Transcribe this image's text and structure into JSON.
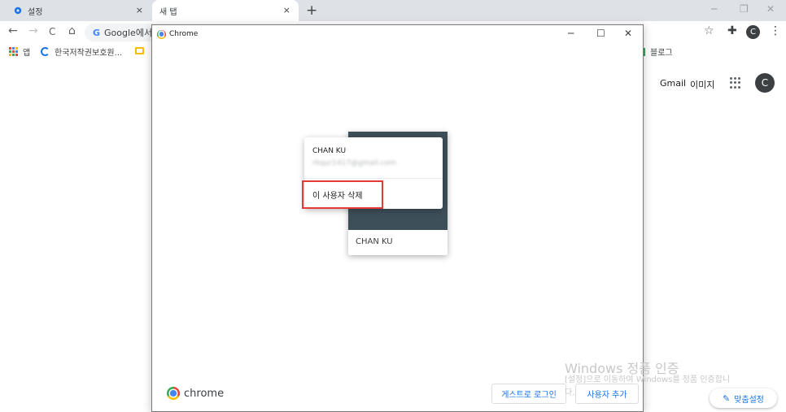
{
  "tabs": [
    {
      "label": "설정",
      "close": "×"
    },
    {
      "label": "새 탭",
      "close": "×"
    }
  ],
  "new_tab_symbol": "+",
  "window_controls": {
    "minimize": "─",
    "restore": "❐",
    "close": "✕"
  },
  "toolbar": {
    "back": "←",
    "forward": "→",
    "reload": "C",
    "home": "⌂",
    "omnibox_text": "Google에서",
    "star": "☆",
    "extensions": "✚",
    "avatar_letter": "C",
    "menu": "⋮"
  },
  "bookmarks": [
    {
      "label": "앱"
    },
    {
      "label": "한국저작권보호원..."
    },
    {
      "label": "블로그"
    }
  ],
  "ntp": {
    "gmail": "Gmail",
    "images": "이미지",
    "avatar_letter": "C"
  },
  "profile_window": {
    "title": "Chrome",
    "controls": {
      "minimize": "─",
      "maximize": "☐",
      "close": "✕"
    },
    "card_name": "CHAN KU",
    "menu": {
      "name": "CHAN KU",
      "email": "rkqur1417@gmail.com",
      "remove_user": "이 사용자 삭제"
    },
    "brand": "chrome",
    "guest_button": "게스트로 로그인",
    "add_user_button": "사용자 추가"
  },
  "watermark": {
    "title": "Windows 정품 인증",
    "line1": "[설정]으로 이동하여 Windows를 정품 인증합니",
    "line2": "다."
  },
  "customize_button": "맞춤설정",
  "colors": {
    "highlight": "#e53935",
    "card_header": "#3d4f58",
    "accent": "#1a73e8"
  }
}
